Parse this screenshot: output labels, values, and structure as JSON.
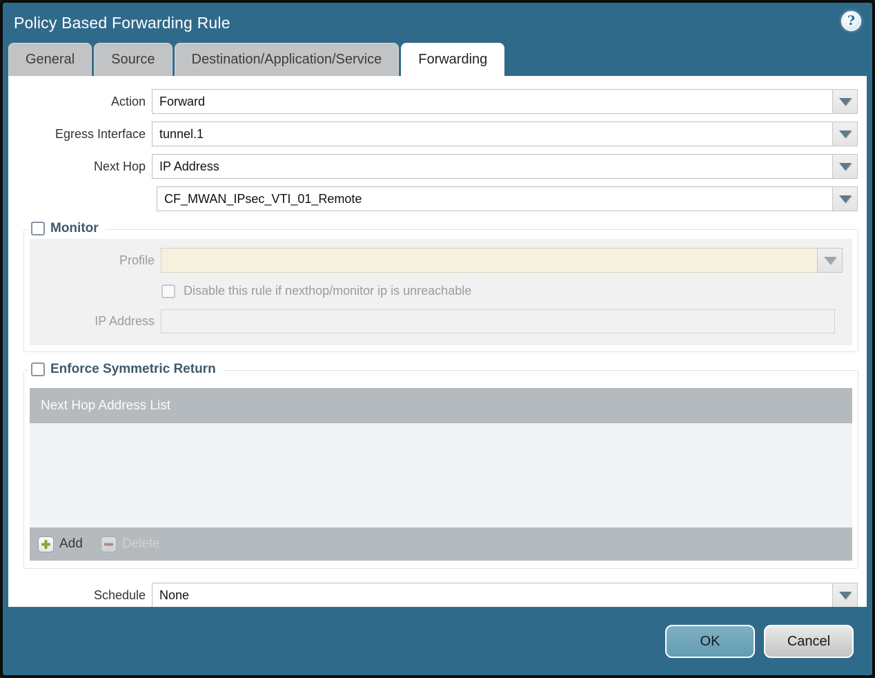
{
  "dialog": {
    "title": "Policy Based Forwarding Rule",
    "help_glyph": "?"
  },
  "colors": {
    "accent_teal": "#306a8b",
    "ok_button": "#6da4ba",
    "legend_text": "#3e5a6c",
    "profile_field_bg": "#f6f1de",
    "table_header_bg": "#b5babe",
    "add_icon_green": "#8aa43c",
    "delete_icon_red": "#a8625a"
  },
  "tabs": [
    {
      "label": "General"
    },
    {
      "label": "Source"
    },
    {
      "label": "Destination/Application/Service"
    },
    {
      "label": "Forwarding"
    }
  ],
  "form": {
    "action": {
      "label": "Action",
      "value": "Forward"
    },
    "egress_interface": {
      "label": "Egress Interface",
      "value": "tunnel.1"
    },
    "next_hop": {
      "label": "Next Hop",
      "value": "IP Address"
    },
    "next_hop_address": {
      "value": "CF_MWAN_IPsec_VTI_01_Remote"
    },
    "schedule": {
      "label": "Schedule",
      "value": "None"
    }
  },
  "monitor": {
    "legend": "Monitor",
    "checked": false,
    "profile_label": "Profile",
    "profile_value": "",
    "disable_rule_label": "Disable this rule if nexthop/monitor ip is unreachable",
    "disable_rule_checked": false,
    "ip_address_label": "IP Address",
    "ip_address_value": ""
  },
  "symmetric_return": {
    "legend": "Enforce Symmetric Return",
    "checked": false,
    "table_header": "Next Hop Address List",
    "rows": [],
    "add_label": "Add",
    "delete_label": "Delete"
  },
  "footer": {
    "ok_label": "OK",
    "cancel_label": "Cancel"
  }
}
